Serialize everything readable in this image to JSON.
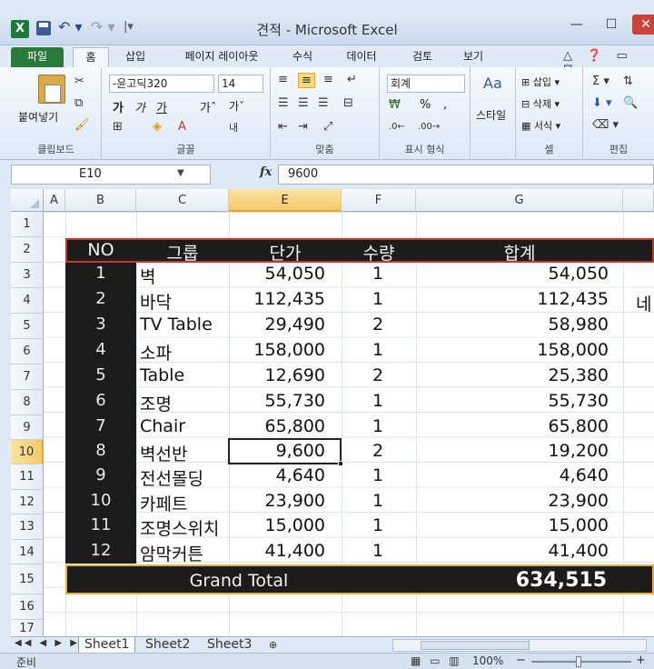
{
  "window": {
    "title": "견적 - Microsoft Excel",
    "app_icon": "X",
    "undo_icon": "↶ ▾",
    "redo_icon": "↷ ▾",
    "qat_more": "|▾",
    "minimize": "—",
    "maximize": "☐",
    "close": "✕"
  },
  "ribbon_tabs": [
    {
      "label": "파일"
    },
    {
      "label": "홈"
    },
    {
      "label": "삽입"
    },
    {
      "label": "페이지 레이아웃"
    },
    {
      "label": "수식"
    },
    {
      "label": "데이터"
    },
    {
      "label": "검토"
    },
    {
      "label": "보기"
    }
  ],
  "ribbon_tab_icons": "△ ❓ ▭ ⊡",
  "ribbon": {
    "clipboard": {
      "paste": "붙여넣기",
      "label": "클립보드"
    },
    "font": {
      "name": "-윤고딕320",
      "size": "14",
      "bold": "가",
      "italic": "가",
      "underline": "가",
      "grow": "가ˆ",
      "shrink": "가ˇ",
      "label": "글꼴"
    },
    "alignment": {
      "label": "맞춤"
    },
    "number": {
      "format": "회계",
      "percent": "%",
      "comma": ",",
      "label": "표시 형식"
    },
    "styles": {
      "label": "스타일"
    },
    "cells": {
      "insert": "삽입",
      "delete": "삭제",
      "format": "서식",
      "label": "셀"
    },
    "editing": {
      "label": "편집"
    }
  },
  "formula_bar": {
    "name_box": "E10",
    "fx": "fx",
    "value": "9600"
  },
  "columns": [
    "A",
    "B",
    "C",
    "E",
    "F",
    "G"
  ],
  "selected_column": "E",
  "rows": [
    "1",
    "2",
    "3",
    "4",
    "5",
    "6",
    "7",
    "8",
    "9",
    "10",
    "11",
    "12",
    "13",
    "14",
    "15",
    "16",
    "17"
  ],
  "selected_row": "10",
  "table": {
    "headers": {
      "no": "NO",
      "group": "그룹",
      "price": "단가",
      "qty": "수량",
      "total": "합계"
    },
    "items": [
      {
        "no": "1",
        "group": "벽",
        "price": "54,050",
        "qty": "1",
        "total": "54,050"
      },
      {
        "no": "2",
        "group": "바닥",
        "price": "112,435",
        "qty": "1",
        "total": "112,435"
      },
      {
        "no": "3",
        "group": "TV Table",
        "price": "29,490",
        "qty": "2",
        "total": "58,980"
      },
      {
        "no": "4",
        "group": "소파",
        "price": "158,000",
        "qty": "1",
        "total": "158,000"
      },
      {
        "no": "5",
        "group": "Table",
        "price": "12,690",
        "qty": "2",
        "total": "25,380"
      },
      {
        "no": "6",
        "group": "조명",
        "price": "55,730",
        "qty": "1",
        "total": "55,730"
      },
      {
        "no": "7",
        "group": "Chair",
        "price": "65,800",
        "qty": "1",
        "total": "65,800"
      },
      {
        "no": "8",
        "group": "벽선반",
        "price": "9,600",
        "qty": "2",
        "total": "19,200"
      },
      {
        "no": "9",
        "group": "전선몰딩",
        "price": "4,640",
        "qty": "1",
        "total": "4,640"
      },
      {
        "no": "10",
        "group": "카페트",
        "price": "23,900",
        "qty": "1",
        "total": "23,900"
      },
      {
        "no": "11",
        "group": "조명스위치",
        "price": "15,000",
        "qty": "1",
        "total": "15,000"
      },
      {
        "no": "12",
        "group": "암막커튼",
        "price": "41,400",
        "qty": "1",
        "total": "41,400"
      }
    ],
    "grand_total_label": "Grand Total",
    "grand_total_value": "634,515",
    "overflow_text": "네"
  },
  "sheet_tabs": [
    "Sheet1",
    "Sheet2",
    "Sheet3"
  ],
  "status": {
    "ready": "준비",
    "zoom": "100%",
    "zoom_minus": "−",
    "zoom_plus": "+"
  }
}
